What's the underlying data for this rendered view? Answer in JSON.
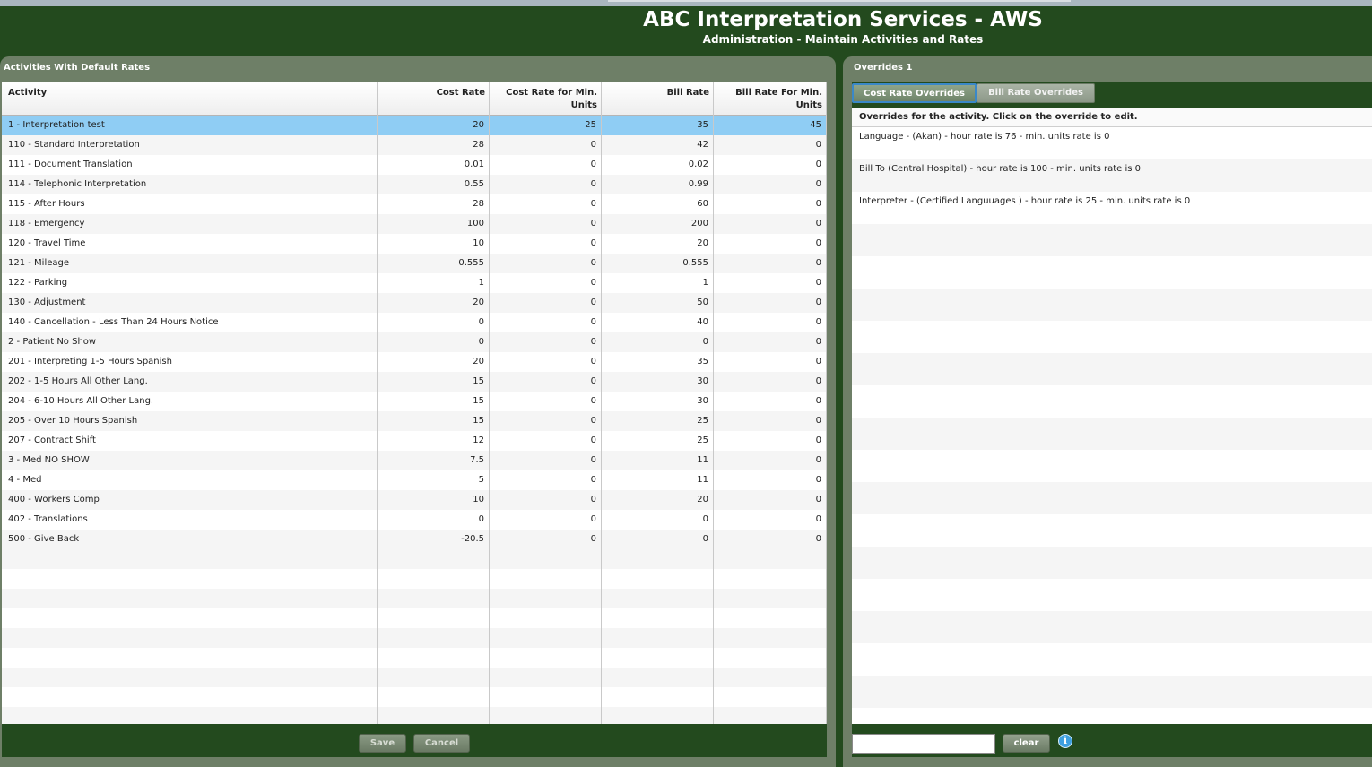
{
  "header": {
    "title": "ABC Interpretation Services - AWS",
    "subtitle": "Administration - Maintain Activities and Rates"
  },
  "left_panel": {
    "title": "Activities With Default Rates",
    "columns": [
      "Activity",
      "Cost Rate",
      "Cost Rate for Min. Units",
      "Bill Rate",
      "Bill Rate For Min. Units"
    ],
    "rows": [
      [
        "1 - Interpretation test",
        "20",
        "25",
        "35",
        "45"
      ],
      [
        "110 - Standard Interpretation",
        "28",
        "0",
        "42",
        "0"
      ],
      [
        "111 - Document Translation",
        "0.01",
        "0",
        "0.02",
        "0"
      ],
      [
        "114 - Telephonic Interpretation",
        "0.55",
        "0",
        "0.99",
        "0"
      ],
      [
        "115 - After Hours",
        "28",
        "0",
        "60",
        "0"
      ],
      [
        "118 - Emergency",
        "100",
        "0",
        "200",
        "0"
      ],
      [
        "120 - Travel Time",
        "10",
        "0",
        "20",
        "0"
      ],
      [
        "121 - Mileage",
        "0.555",
        "0",
        "0.555",
        "0"
      ],
      [
        "122 - Parking",
        "1",
        "0",
        "1",
        "0"
      ],
      [
        "130 - Adjustment",
        "20",
        "0",
        "50",
        "0"
      ],
      [
        "140 - Cancellation - Less Than 24 Hours Notice",
        "0",
        "0",
        "40",
        "0"
      ],
      [
        "2 - Patient No Show",
        "0",
        "0",
        "0",
        "0"
      ],
      [
        "201 - Interpreting 1-5 Hours Spanish",
        "20",
        "0",
        "35",
        "0"
      ],
      [
        "202 - 1-5 Hours All Other Lang.",
        "15",
        "0",
        "30",
        "0"
      ],
      [
        "204 - 6-10 Hours All Other Lang.",
        "15",
        "0",
        "30",
        "0"
      ],
      [
        "205 - Over 10 Hours Spanish",
        "15",
        "0",
        "25",
        "0"
      ],
      [
        "207 - Contract Shift",
        "12",
        "0",
        "25",
        "0"
      ],
      [
        "3 - Med NO SHOW",
        "7.5",
        "0",
        "11",
        "0"
      ],
      [
        "4 - Med",
        "5",
        "0",
        "11",
        "0"
      ],
      [
        "400 - Workers Comp",
        "10",
        "0",
        "20",
        "0"
      ],
      [
        "402 - Translations",
        "0",
        "0",
        "0",
        "0"
      ],
      [
        "500 - Give Back",
        "-20.5",
        "0",
        "0",
        "0"
      ]
    ],
    "selected_row": 0,
    "save_label": "Save",
    "cancel_label": "Cancel"
  },
  "right_panel": {
    "title": "Overrides 1",
    "tabs": [
      "Cost Rate Overrides",
      "Bill Rate Overrides"
    ],
    "active_tab": 0,
    "instructions": "Overrides for the activity.  Click on the override to edit.",
    "overrides": [
      "Language - (Akan)  - hour rate is 76 - min. units rate is 0",
      "Bill To (Central Hospital)  - hour rate is 100 - min. units rate is 0",
      "Interpreter - (Certified Languuages )  - hour rate is 25 - min. units rate is 0"
    ],
    "search_value": "",
    "clear_label": "clear",
    "info_icon": "info-icon"
  }
}
